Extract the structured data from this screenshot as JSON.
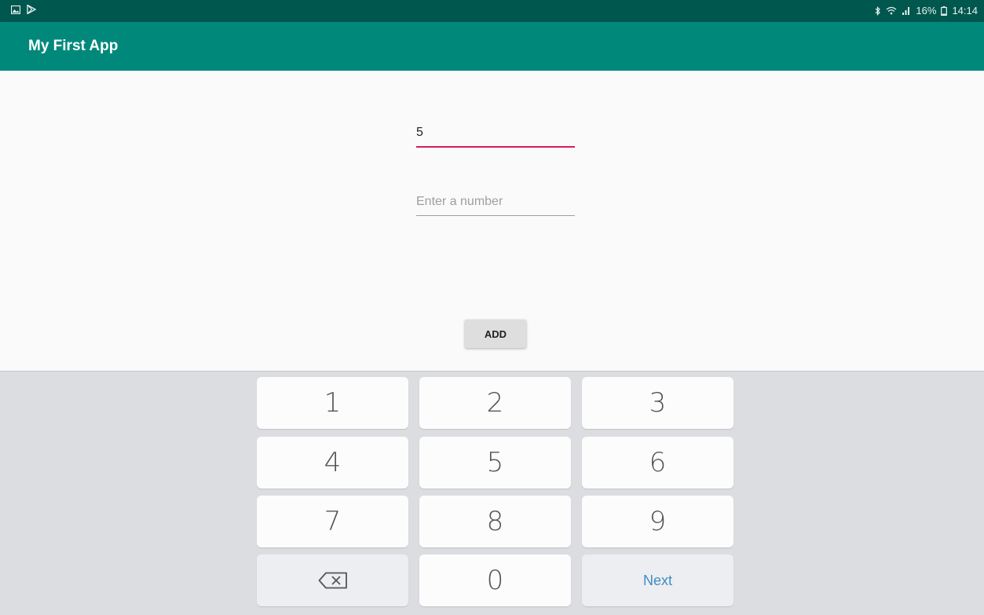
{
  "status_bar": {
    "left_icons": [
      "gallery-icon",
      "play-store-icon"
    ],
    "right_icons": [
      "bluetooth-icon",
      "wifi-icon",
      "signal-icon"
    ],
    "battery": "16%",
    "battery_icon": "battery-icon",
    "time": "14:14"
  },
  "app_bar": {
    "title": "My First App",
    "color": "#00897b"
  },
  "form": {
    "field1": {
      "value": "5",
      "placeholder": ""
    },
    "field2": {
      "value": "",
      "placeholder": "Enter a number"
    },
    "add_button": "ADD"
  },
  "keyboard": {
    "keys": [
      "1",
      "2",
      "3",
      "4",
      "5",
      "6",
      "7",
      "8",
      "9",
      "0"
    ],
    "backspace_icon": "backspace-icon",
    "next_label": "Next"
  }
}
